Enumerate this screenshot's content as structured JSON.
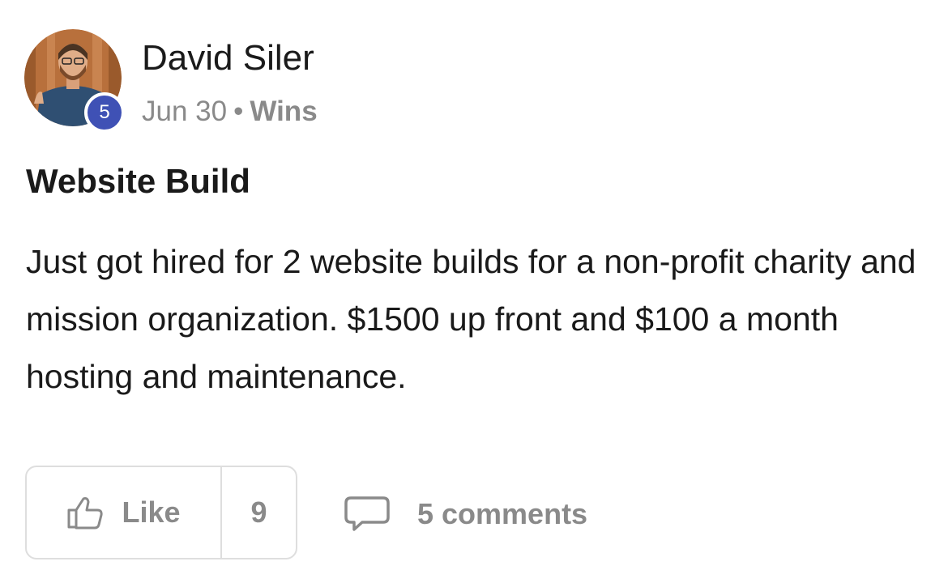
{
  "author": {
    "name": "David Siler",
    "level": "5"
  },
  "meta": {
    "date": "Jun 30",
    "separator": "•",
    "category": "Wins"
  },
  "post": {
    "title": "Website Build",
    "body": "Just got hired for 2 website builds for a non-profit charity and mission organization. $1500 up front and $100 a month hosting and maintenance."
  },
  "actions": {
    "like_label": "Like",
    "like_count": "9",
    "comments_label": "5 comments"
  },
  "colors": {
    "level_badge": "#3f51b5",
    "muted_text": "#8a8a8a",
    "border": "#dedede"
  }
}
